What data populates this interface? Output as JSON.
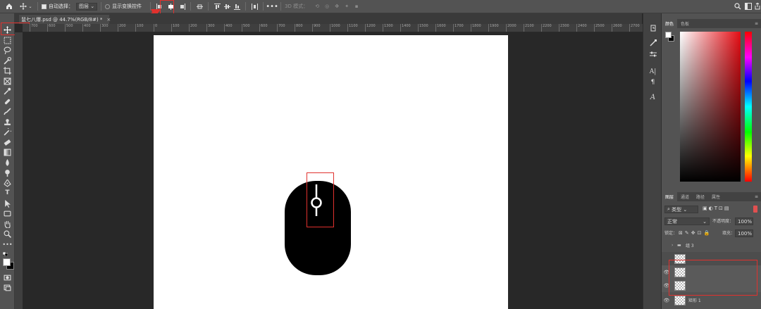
{
  "options_bar": {
    "auto_select_label": "自动选择：",
    "auto_select_value": "图层",
    "show_transform_label": "显示变换控件",
    "mode_3d_label": "3D 模式："
  },
  "document_tab": {
    "title": "鼠七八爆.psd @ 44.7%(RGB/8#) *",
    "close": "×"
  },
  "ruler": {
    "ticks": [
      "700",
      "600",
      "500",
      "400",
      "300",
      "200",
      "100",
      "0",
      "100",
      "200",
      "300",
      "400",
      "500",
      "600",
      "700",
      "800",
      "900",
      "1000",
      "1100",
      "1200",
      "1300",
      "1400",
      "1500",
      "1600",
      "1700",
      "1800",
      "1900",
      "2000",
      "2100",
      "2200",
      "2300",
      "2400",
      "2500",
      "2600",
      "2700"
    ]
  },
  "panels": {
    "color_tabs": [
      "颜色",
      "色板"
    ],
    "layers_tabs": [
      "图层",
      "通道",
      "路径",
      "属性"
    ],
    "filter_label": "类型",
    "blend_mode": "正常",
    "opacity_label": "不透明度：",
    "opacity_value": "100%",
    "lock_label": "锁定：",
    "fill_label": "填充：",
    "fill_value": "100%"
  },
  "layers": [
    {
      "name": "组 3",
      "type": "group"
    },
    {
      "name": "",
      "type": "layer"
    },
    {
      "name": "",
      "type": "layer"
    },
    {
      "name": "",
      "type": "layer"
    },
    {
      "name": "矩形 1",
      "type": "layer"
    }
  ],
  "colors": {
    "annotation_red": "#e0312e",
    "canvas_bg": "#282828",
    "document_bg": "#ffffff",
    "mouse_fill": "#000000"
  },
  "icons": [
    "home-icon",
    "move-icon",
    "align-left-icon",
    "align-center-icon",
    "align-right-icon",
    "distribute-icon",
    "more-icon",
    "search-icon",
    "workspace-icon",
    "share-icon"
  ]
}
